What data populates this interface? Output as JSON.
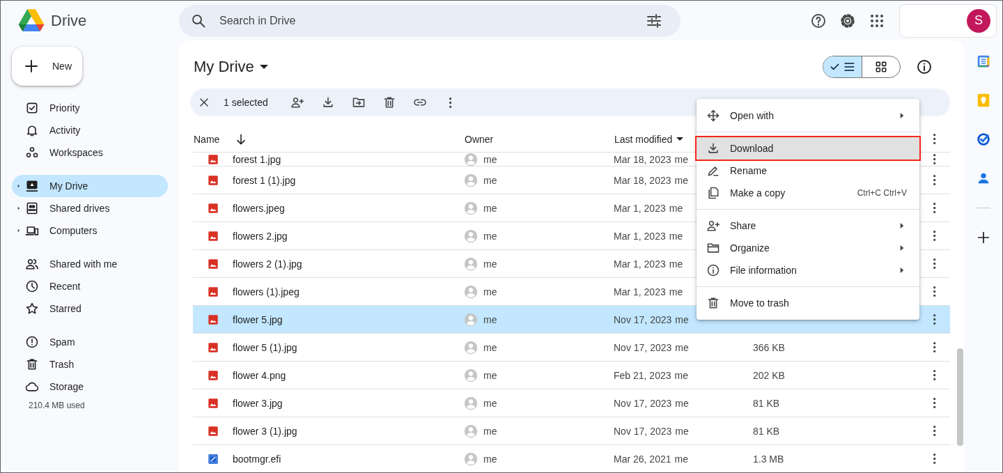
{
  "app": {
    "title": "Drive"
  },
  "search": {
    "placeholder": "Search in Drive"
  },
  "account": {
    "initial": "S"
  },
  "new_button": {
    "label": "New"
  },
  "sidebar": {
    "groups": [
      [
        {
          "label": "Priority",
          "kind": "priority",
          "selected": false,
          "expandable": false
        },
        {
          "label": "Activity",
          "kind": "activity",
          "selected": false,
          "expandable": false
        },
        {
          "label": "Workspaces",
          "kind": "workspaces",
          "selected": false,
          "expandable": false
        }
      ],
      [
        {
          "label": "My Drive",
          "kind": "my-drive",
          "selected": true,
          "expandable": true
        },
        {
          "label": "Shared drives",
          "kind": "shared-drives",
          "selected": false,
          "expandable": true
        },
        {
          "label": "Computers",
          "kind": "computers",
          "selected": false,
          "expandable": true
        }
      ],
      [
        {
          "label": "Shared with me",
          "kind": "shared",
          "selected": false,
          "expandable": false
        },
        {
          "label": "Recent",
          "kind": "recent",
          "selected": false,
          "expandable": false
        },
        {
          "label": "Starred",
          "kind": "starred",
          "selected": false,
          "expandable": false
        }
      ],
      [
        {
          "label": "Spam",
          "kind": "spam",
          "selected": false,
          "expandable": false
        },
        {
          "label": "Trash",
          "kind": "trash",
          "selected": false,
          "expandable": false
        },
        {
          "label": "Storage",
          "kind": "storage",
          "selected": false,
          "expandable": false
        }
      ]
    ],
    "storage_used": "210.4 MB used"
  },
  "page_title": "My Drive",
  "view_toggle": [
    {
      "kind": "list",
      "selected": true
    },
    {
      "kind": "grid",
      "selected": false
    }
  ],
  "selection_bar": {
    "count": "1 selected"
  },
  "table": {
    "columns": [
      {
        "label": "Name",
        "kind": "name"
      },
      {
        "label": "Owner",
        "kind": "owner"
      },
      {
        "label": "Last modified",
        "kind": "modified"
      }
    ],
    "rows": [
      {
        "name": "forest 1.jpg",
        "kind": "image",
        "owner": "me",
        "modified": "Mar 18, 2023",
        "modified_by": "me",
        "selected": false
      },
      {
        "name": "forest 1 (1).jpg",
        "kind": "image",
        "owner": "me",
        "modified": "Mar 18, 2023",
        "modified_by": "me",
        "selected": false
      },
      {
        "name": "flowers.jpeg",
        "kind": "image",
        "owner": "me",
        "modified": "Mar 1, 2023",
        "modified_by": "me",
        "selected": false
      },
      {
        "name": "flowers 2.jpg",
        "kind": "image",
        "owner": "me",
        "modified": "Mar 1, 2023",
        "modified_by": "me",
        "selected": false
      },
      {
        "name": "flowers 2 (1).jpg",
        "kind": "image",
        "owner": "me",
        "modified": "Mar 1, 2023",
        "modified_by": "me",
        "selected": false
      },
      {
        "name": "flowers (1).jpeg",
        "kind": "image",
        "owner": "me",
        "modified": "Mar 1, 2023",
        "modified_by": "me",
        "selected": false
      },
      {
        "name": "flower 5.jpg",
        "kind": "image",
        "owner": "me",
        "modified": "Nov 17, 2023",
        "modified_by": "me",
        "selected": true
      },
      {
        "name": "flower 5 (1).jpg",
        "kind": "image",
        "owner": "me",
        "modified": "Nov 17, 2023",
        "modified_by": "me",
        "size": "366 KB",
        "selected": false
      },
      {
        "name": "flower 4.png",
        "kind": "image",
        "owner": "me",
        "modified": "Feb 21, 2023",
        "modified_by": "me",
        "size": "202 KB",
        "selected": false
      },
      {
        "name": "flower 3.jpg",
        "kind": "image",
        "owner": "me",
        "modified": "Nov 17, 2023",
        "modified_by": "me",
        "size": "81 KB",
        "selected": false
      },
      {
        "name": "flower 3 (1).jpg",
        "kind": "image",
        "owner": "me",
        "modified": "Nov 17, 2023",
        "modified_by": "me",
        "size": "81 KB",
        "selected": false
      },
      {
        "name": "bootmgr.efi",
        "kind": "binary",
        "owner": "me",
        "modified": "Mar 26, 2021",
        "modified_by": "me",
        "size": "1.3 MB",
        "selected": false
      }
    ]
  },
  "context_menu": {
    "sections": [
      [
        {
          "label": "Open with",
          "kind": "open-with",
          "submenu": true,
          "highlighted": false
        }
      ],
      [
        {
          "label": "Download",
          "kind": "download",
          "submenu": false,
          "highlighted": true
        },
        {
          "label": "Rename",
          "kind": "rename",
          "submenu": false,
          "highlighted": false
        },
        {
          "label": "Make a copy",
          "kind": "copy",
          "shortcut": "Ctrl+C Ctrl+V",
          "submenu": false,
          "highlighted": false
        }
      ],
      [
        {
          "label": "Share",
          "kind": "share",
          "submenu": true,
          "highlighted": false
        },
        {
          "label": "Organize",
          "kind": "organize",
          "submenu": true,
          "highlighted": false
        },
        {
          "label": "File information",
          "kind": "info",
          "submenu": true,
          "highlighted": false
        }
      ],
      [
        {
          "label": "Move to trash",
          "kind": "trash",
          "submenu": false,
          "highlighted": false
        }
      ]
    ]
  }
}
